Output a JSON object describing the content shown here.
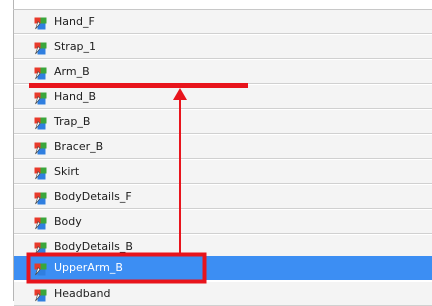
{
  "layers": {
    "items": [
      {
        "label": "Hand_F"
      },
      {
        "label": "Strap_1"
      },
      {
        "label": "Arm_B"
      },
      {
        "label": "Hand_B"
      },
      {
        "label": "Trap_B"
      },
      {
        "label": "Bracer_B"
      },
      {
        "label": "Skirt"
      },
      {
        "label": "BodyDetails_F"
      },
      {
        "label": "Body"
      },
      {
        "label": "BodyDetails_B"
      },
      {
        "label": "UpperArm_B",
        "selected": true
      },
      {
        "label": "Headband"
      }
    ]
  },
  "colors": {
    "selection": "#3c8ef3",
    "annotation": "#e8141c",
    "icon_red": "#e83a2a",
    "icon_green": "#3aa63a",
    "icon_blue": "#2f7fe0"
  }
}
